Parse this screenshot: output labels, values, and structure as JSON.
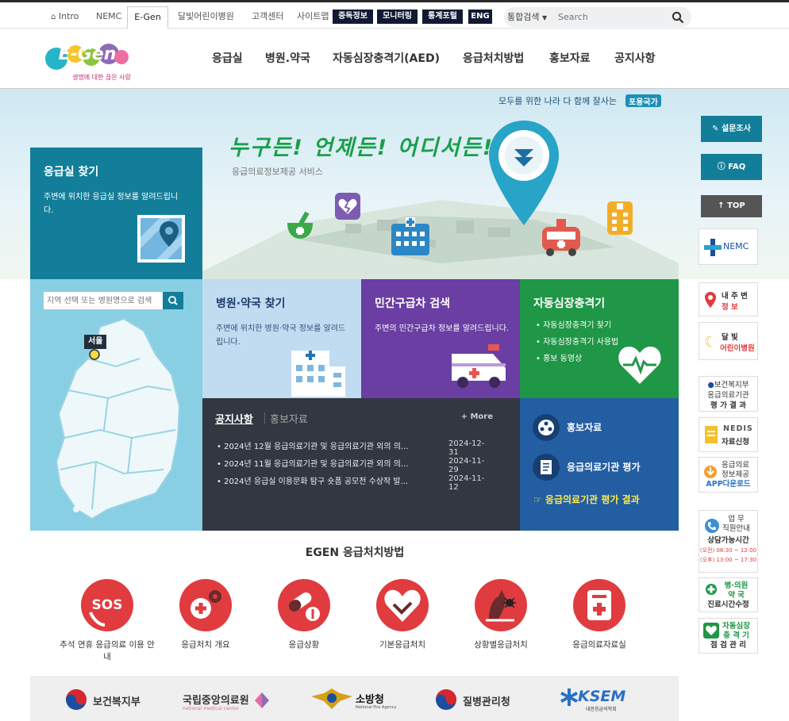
{
  "topbar": {
    "links": [
      "Intro",
      "NEMC",
      "E-Gen",
      "달빛어린이병원",
      "고객센터",
      "사이트맵"
    ],
    "dark_buttons": [
      "중독정보",
      "모니터링",
      "통계포털",
      "ENG"
    ],
    "search": {
      "scope": "통합검색",
      "placeholder": "Search"
    }
  },
  "header": {
    "logo_text": "E-Gen",
    "logo_tagline": "생명에 대한 끊은 사랑",
    "nav": [
      "응급실",
      "병원.약국",
      "자동심장충격기(AED)",
      "응급처치방법",
      "홍보자료",
      "공지사항"
    ]
  },
  "hero": {
    "slogan": "모두를 위한 나라 다 함께 잘사는",
    "slogan_badge": "포용국가",
    "title": "누구든! 언제든! 어디서든!",
    "subtitle": "응급의료정보제공 서비스"
  },
  "tiles": {
    "er": {
      "title": "응급실 찾기",
      "desc": "주변에 위치한 응급실 정보를 알려드립니다."
    },
    "map": {
      "placeholder": "지역 선택 또는 병원명으로 검색",
      "label": "서울"
    },
    "hospital": {
      "title": "병원·약국 찾기",
      "desc": "주변에 위치한 병원·약국 정보를 알려드립니다."
    },
    "ambulance": {
      "title": "민간구급차 검색",
      "desc": "주변의 민간구급차 정보를 알려드립니다."
    },
    "aed": {
      "title": "자동심장충격기",
      "items": [
        "자동심장충격기 찾기",
        "자동심장충격기 사용법",
        "홍보 동영상"
      ]
    }
  },
  "notice": {
    "tab_active": "공지사항",
    "tab_inactive": "홍보자료",
    "more": "+ More",
    "rows": [
      {
        "title": "• 2024년 12월 응급의료기관 및 응급의료기관 외의 의...",
        "date": "2024-12-31"
      },
      {
        "title": "• 2024년 11월 응급의료기관 및 응급의료기관 외의 의...",
        "date": "2024-11-29"
      },
      {
        "title": "• 2024년 응급실 이용문화 탐구 숏폼 공모전 수상작 발...",
        "date": "2024-11-12"
      }
    ]
  },
  "promo": {
    "items": [
      "홍보자료",
      "응급의료기관 평가"
    ],
    "link": "☞ 응급의료기관 평가 결과"
  },
  "first_aid": {
    "title": "EGEN 응급처치방법",
    "items": [
      "추석 연휴 응급의료 이용 안내",
      "응급처치 개요",
      "응급상황",
      "기본응급처치",
      "상황별응급처치",
      "응급의료자료실"
    ]
  },
  "logos": [
    "보건복지부",
    "국립중앙의료원",
    "소방청",
    "질병관리청",
    "KSEM"
  ],
  "logo_subs": {
    "nmc": "national medical center",
    "ksem": "대한응급의학회",
    "fire": "National Fire Agency"
  },
  "rail": {
    "survey": "설문조사",
    "faq": "FAQ",
    "top": "↑ TOP",
    "boxes": [
      {
        "line1": "NEMC"
      },
      {
        "line1": "내 주 변",
        "line2": "정  보"
      },
      {
        "line1": "달    빛",
        "line2": "어린이병원"
      },
      {
        "line1": "보건복지부",
        "line2": "응급의료기관",
        "line3": "평 가 결 과"
      },
      {
        "line1": "NEDIS",
        "line2": "자료신청"
      },
      {
        "line1": "응급의료",
        "line2": "정보제공",
        "line3": "APP다운로드"
      },
      {
        "line1": "업    무",
        "line2": "직원안내",
        "line3": "상담가능시간",
        "line4": "(오전) 08:30 ~ 12:00",
        "line5": "(오후) 13:00 ~ 17:30"
      },
      {
        "line1": "병·의원",
        "line2": "약    국",
        "line3": "진료시간수정"
      },
      {
        "line1": "자동심장",
        "line2": "충 격 기",
        "line3": "점 검 관 리"
      }
    ]
  },
  "colors": {
    "teal": "#137e99",
    "purple": "#6a3ea3",
    "green": "#209647",
    "navy": "#235ea3",
    "dark": "#333742",
    "red": "#e03b3f"
  }
}
